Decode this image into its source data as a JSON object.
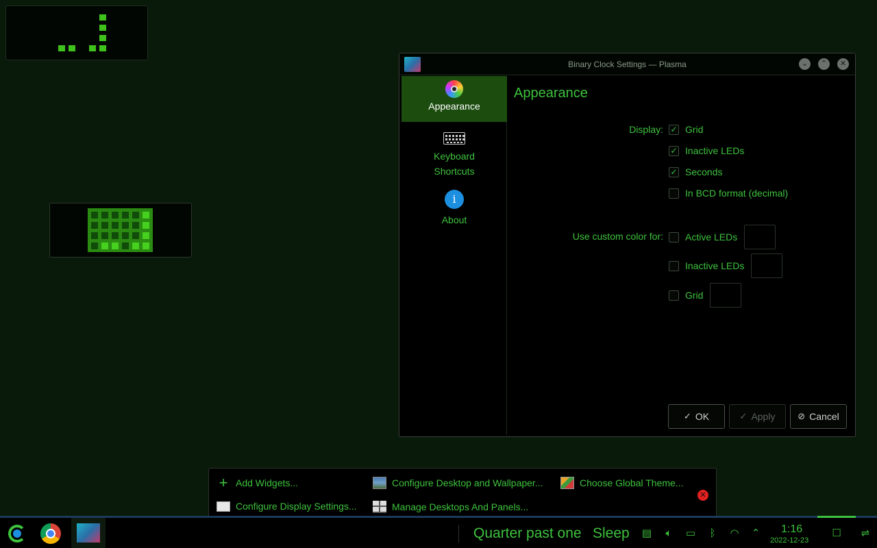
{
  "colors": {
    "accent": "#3ec23e",
    "background": "#0a1a0a",
    "selected": "#1c4d0f"
  },
  "dialog": {
    "title": "Binary Clock Settings — Plasma",
    "sidebar": [
      {
        "label": "Appearance",
        "icon": "color-wheel-icon"
      },
      {
        "label": "Keyboard Shortcuts",
        "icon": "keyboard-icon"
      },
      {
        "label": "About",
        "icon": "info-icon"
      }
    ],
    "page_title": "Appearance",
    "display_label": "Display:",
    "display_options": [
      {
        "label": "Grid",
        "checked": true
      },
      {
        "label": "Inactive LEDs",
        "checked": true
      },
      {
        "label": "Seconds",
        "checked": true
      },
      {
        "label": "In BCD format (decimal)",
        "checked": false
      }
    ],
    "custom_color_label": "Use custom color for:",
    "custom_color_options": [
      {
        "label": "Active LEDs",
        "checked": false
      },
      {
        "label": "Inactive LEDs",
        "checked": false
      },
      {
        "label": "Grid",
        "checked": false
      }
    ],
    "buttons": {
      "ok": "OK",
      "apply": "Apply",
      "cancel": "Cancel"
    }
  },
  "toolbox": {
    "add_widgets": "Add Widgets...",
    "configure_desktop": "Configure Desktop and Wallpaper...",
    "global_theme": "Choose Global Theme...",
    "display_settings": "Configure Display Settings...",
    "manage_desktops": "Manage Desktops And Panels..."
  },
  "taskbar": {
    "fuzzy_clock": "Quarter past one",
    "sleep": "Sleep",
    "time": "1:16",
    "date": "2022-12-23"
  }
}
